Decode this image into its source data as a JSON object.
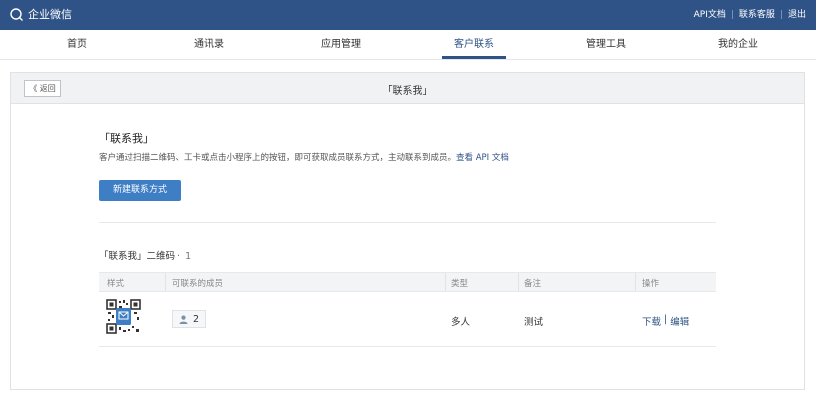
{
  "app": {
    "name": "企业微信",
    "logo_icon": "chat-bubble-icon"
  },
  "top_links": {
    "api_docs": "API文档",
    "support": "联系客服",
    "logout": "退出"
  },
  "nav": {
    "items": [
      "首页",
      "通讯录",
      "应用管理",
      "客户联系",
      "管理工具",
      "我的企业"
    ],
    "active_index": 3
  },
  "panel": {
    "back_label": "《 返回",
    "title": "「联系我」"
  },
  "intro": {
    "title": "「联系我」",
    "description": "客户通过扫描二维码、工卡或点击小程序上的按钮，即可获取成员联系方式，主动联系到成员。",
    "link": "查看 API 文档",
    "create_button": "新建联系方式"
  },
  "list": {
    "title": "「联系我」二维码",
    "count_prefix": "· ",
    "count": "1",
    "columns": [
      "样式",
      "可联系的成员",
      "类型",
      "备注",
      "操作"
    ],
    "rows": [
      {
        "members": "2",
        "type": "多人",
        "note": "测试",
        "download": "下载",
        "op_separator": "|",
        "edit": "编辑"
      }
    ]
  },
  "colors": {
    "brand": "#2f5387",
    "button": "#3e7ec5"
  }
}
